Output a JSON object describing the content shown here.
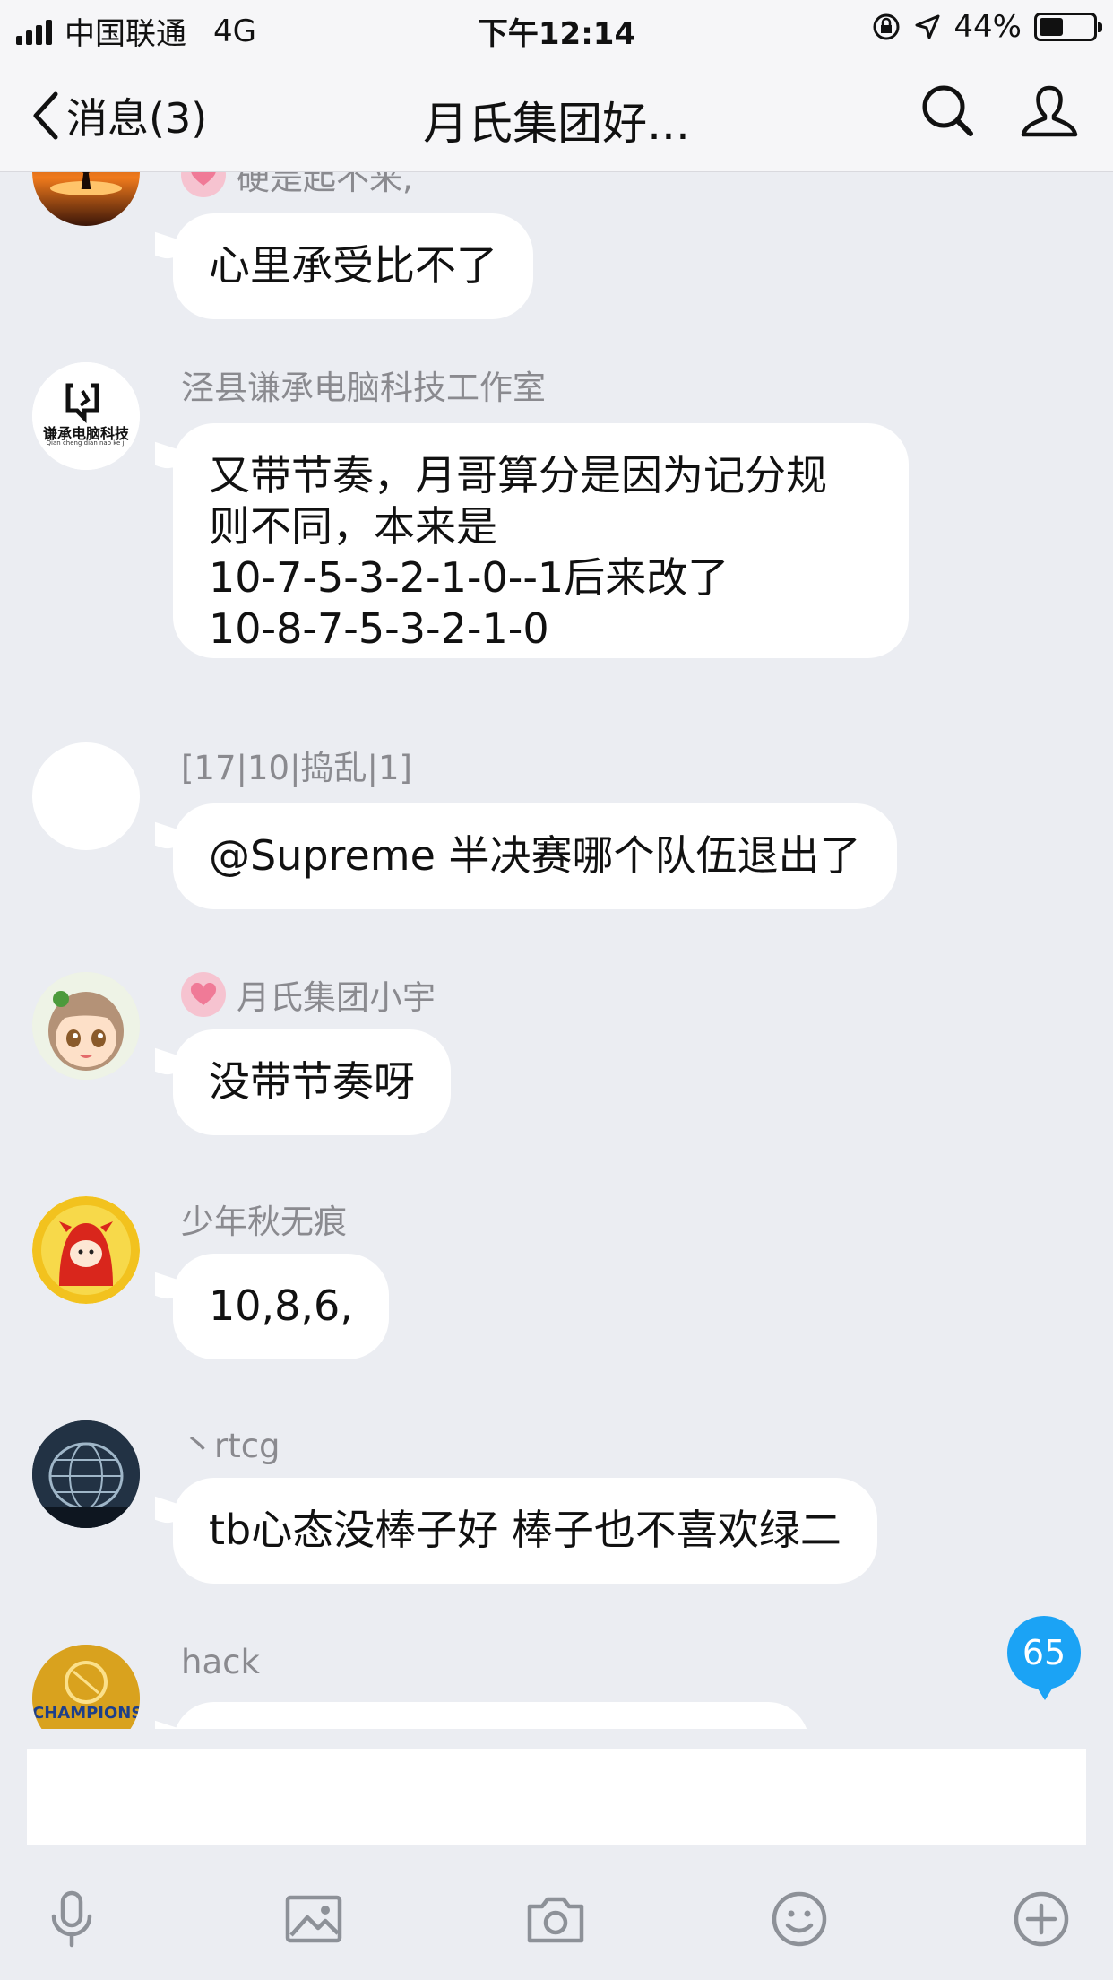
{
  "status_bar": {
    "carrier": "中国联通",
    "network": "4G",
    "time": "下午12:14",
    "battery": "44%",
    "battery_level": 0.44
  },
  "nav": {
    "back_label": "消息(3)",
    "title": "月氏集团好..."
  },
  "messages": [
    {
      "sender": "硬是起不来,",
      "text": [
        "心里承受比不了"
      ],
      "avatar": "sunset-avatar"
    },
    {
      "sender": "泾县谦承电脑科技工作室",
      "text": [
        "又带节奏，月哥算分是因为记分规",
        "则不同，本来是",
        "10-7-5-3-2-1-0--1后来改了",
        "10-8-7-5-3-2-1-0"
      ],
      "avatar": "logo-avatar",
      "logo_title": "谦承电脑科技",
      "logo_sub": "Qian cheng dian nao ke ji"
    },
    {
      "sender": "[17|10|捣乱|1]",
      "text": [
        "@Supreme 半决赛哪个队伍退出了"
      ],
      "avatar": "blank-avatar"
    },
    {
      "sender": "月氏集团小宇",
      "text": [
        "没带节奏呀"
      ],
      "avatar": "anime-avatar"
    },
    {
      "sender": "少年秋无痕",
      "text": [
        "10,8,6,"
      ],
      "avatar": "cartoon-avatar"
    },
    {
      "sender": "丶rtcg",
      "text": [
        "tb心态没棒子好 棒子也不喜欢绿二"
      ],
      "avatar": "globe-avatar"
    },
    {
      "sender": "hack",
      "text": [],
      "avatar": "champions-avatar",
      "avatar_text": "CHAMPIONS"
    }
  ],
  "unread_badge": "65",
  "input": {
    "placeholder": ""
  },
  "toolbar": [
    "microphone-icon",
    "image-icon",
    "camera-icon",
    "emoji-icon",
    "plus-icon"
  ]
}
